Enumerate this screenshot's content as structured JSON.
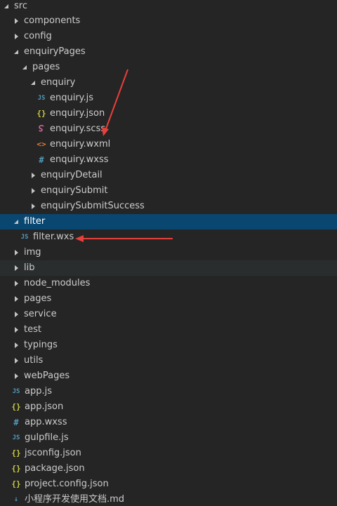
{
  "tree": {
    "root": "src",
    "items": [
      {
        "name": "components"
      },
      {
        "name": "config"
      },
      {
        "name": "enquiryPages"
      },
      {
        "name": "pages"
      },
      {
        "name": "enquiry"
      },
      {
        "name": "enquiry.js",
        "icon": "js-file-icon",
        "glyph": "JS"
      },
      {
        "name": "enquiry.json",
        "icon": "json-file-icon",
        "glyph": "{}"
      },
      {
        "name": "enquiry.scss",
        "icon": "sass-file-icon"
      },
      {
        "name": "enquiry.wxml",
        "icon": "xml-file-icon",
        "glyph": "<>"
      },
      {
        "name": "enquiry.wxss",
        "icon": "hash-file-icon",
        "glyph": "#"
      },
      {
        "name": "enquiryDetail"
      },
      {
        "name": "enquirySubmit"
      },
      {
        "name": "enquirySubmitSuccess"
      },
      {
        "name": "filter"
      },
      {
        "name": "filter.wxs",
        "icon": "js-file-icon",
        "glyph": "JS"
      },
      {
        "name": "img"
      },
      {
        "name": "lib"
      },
      {
        "name": "node_modules"
      },
      {
        "name": "pages"
      },
      {
        "name": "service"
      },
      {
        "name": "test"
      },
      {
        "name": "typings"
      },
      {
        "name": "utils"
      },
      {
        "name": "webPages"
      },
      {
        "name": "app.js",
        "icon": "js-file-icon",
        "glyph": "JS"
      },
      {
        "name": "app.json",
        "icon": "json-file-icon",
        "glyph": "{}"
      },
      {
        "name": "app.wxss",
        "icon": "hash-file-icon",
        "glyph": "#"
      },
      {
        "name": "gulpfile.js",
        "icon": "js-file-icon",
        "glyph": "JS"
      },
      {
        "name": "jsconfig.json",
        "icon": "json-file-icon",
        "glyph": "{}"
      },
      {
        "name": "package.json",
        "icon": "json-file-icon",
        "glyph": "{}"
      },
      {
        "name": "project.config.json",
        "icon": "json-file-icon",
        "glyph": "{}"
      },
      {
        "name": "小程序开发使用文档.md",
        "icon": "markdown-file-icon",
        "glyph": "↓"
      }
    ]
  },
  "colors": {
    "background": "#252526",
    "text": "#cccccc",
    "selected_background": "#094771",
    "hover_background": "#2a2d2e",
    "annotation_arrow": "#e8403a"
  }
}
